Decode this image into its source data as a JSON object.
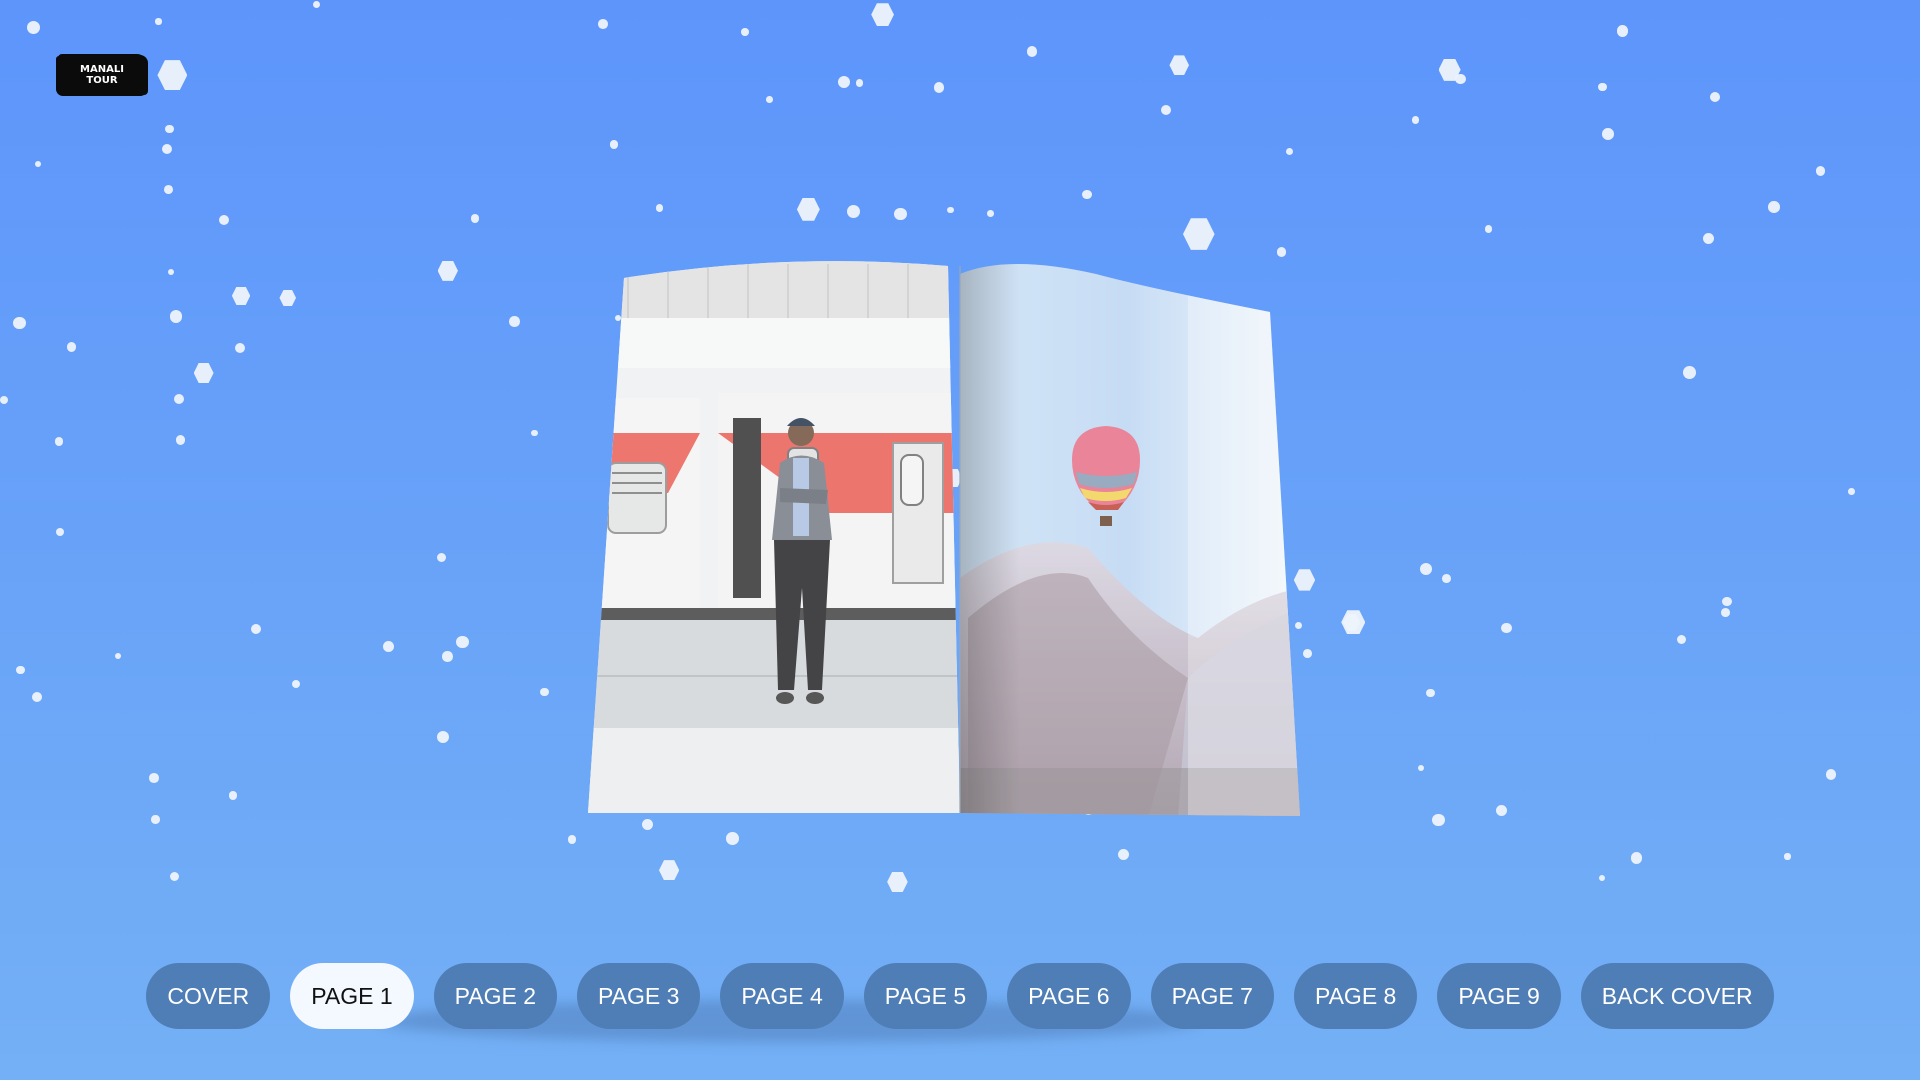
{
  "app": {
    "logo_text": "MANALI\nTOUR"
  },
  "book": {
    "left_page": {
      "photo": "man-standing-by-red-train-photo"
    },
    "right_page": {
      "photo": "hot-air-balloon-over-mountains-photo"
    }
  },
  "nav": {
    "active_index": 1,
    "items": [
      {
        "label": "COVER"
      },
      {
        "label": "PAGE 1"
      },
      {
        "label": "PAGE 2"
      },
      {
        "label": "PAGE 3"
      },
      {
        "label": "PAGE 4"
      },
      {
        "label": "PAGE 5"
      },
      {
        "label": "PAGE 6"
      },
      {
        "label": "PAGE 7"
      },
      {
        "label": "PAGE 8"
      },
      {
        "label": "PAGE 9"
      },
      {
        "label": "BACK COVER"
      }
    ]
  },
  "colors": {
    "background_top": "#5d95fb",
    "background_bottom": "#74b0f5",
    "nav_button": "#4f7db5",
    "nav_button_active": "#f4f8ff"
  }
}
